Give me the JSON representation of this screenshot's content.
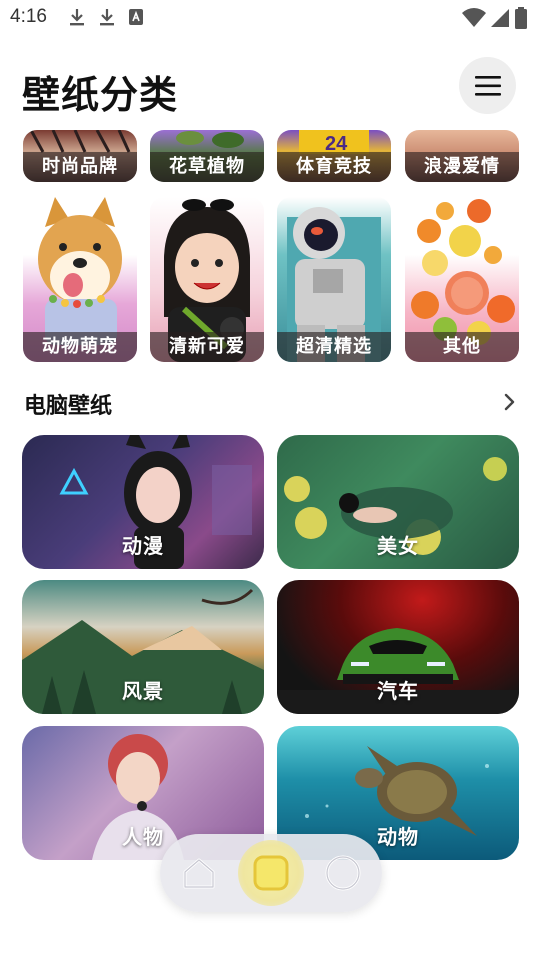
{
  "status_bar": {
    "time": "4:16"
  },
  "header": {
    "title": "壁纸分类"
  },
  "categories": [
    {
      "label": "时尚品牌"
    },
    {
      "label": "花草植物"
    },
    {
      "label": "体育竞技"
    },
    {
      "label": "浪漫爱情"
    },
    {
      "label": "动物萌宠"
    },
    {
      "label": "清新可爱"
    },
    {
      "label": "超清精选"
    },
    {
      "label": "其他"
    }
  ],
  "pc_section": {
    "title": "电脑壁纸",
    "cards": [
      {
        "label": "动漫"
      },
      {
        "label": "美女"
      },
      {
        "label": "风景"
      },
      {
        "label": "汽车"
      },
      {
        "label": "人物"
      },
      {
        "label": "动物"
      }
    ]
  },
  "colors": {
    "accent_nav": "#f3e98a",
    "tile_label_bg": "#3b2e2e"
  }
}
